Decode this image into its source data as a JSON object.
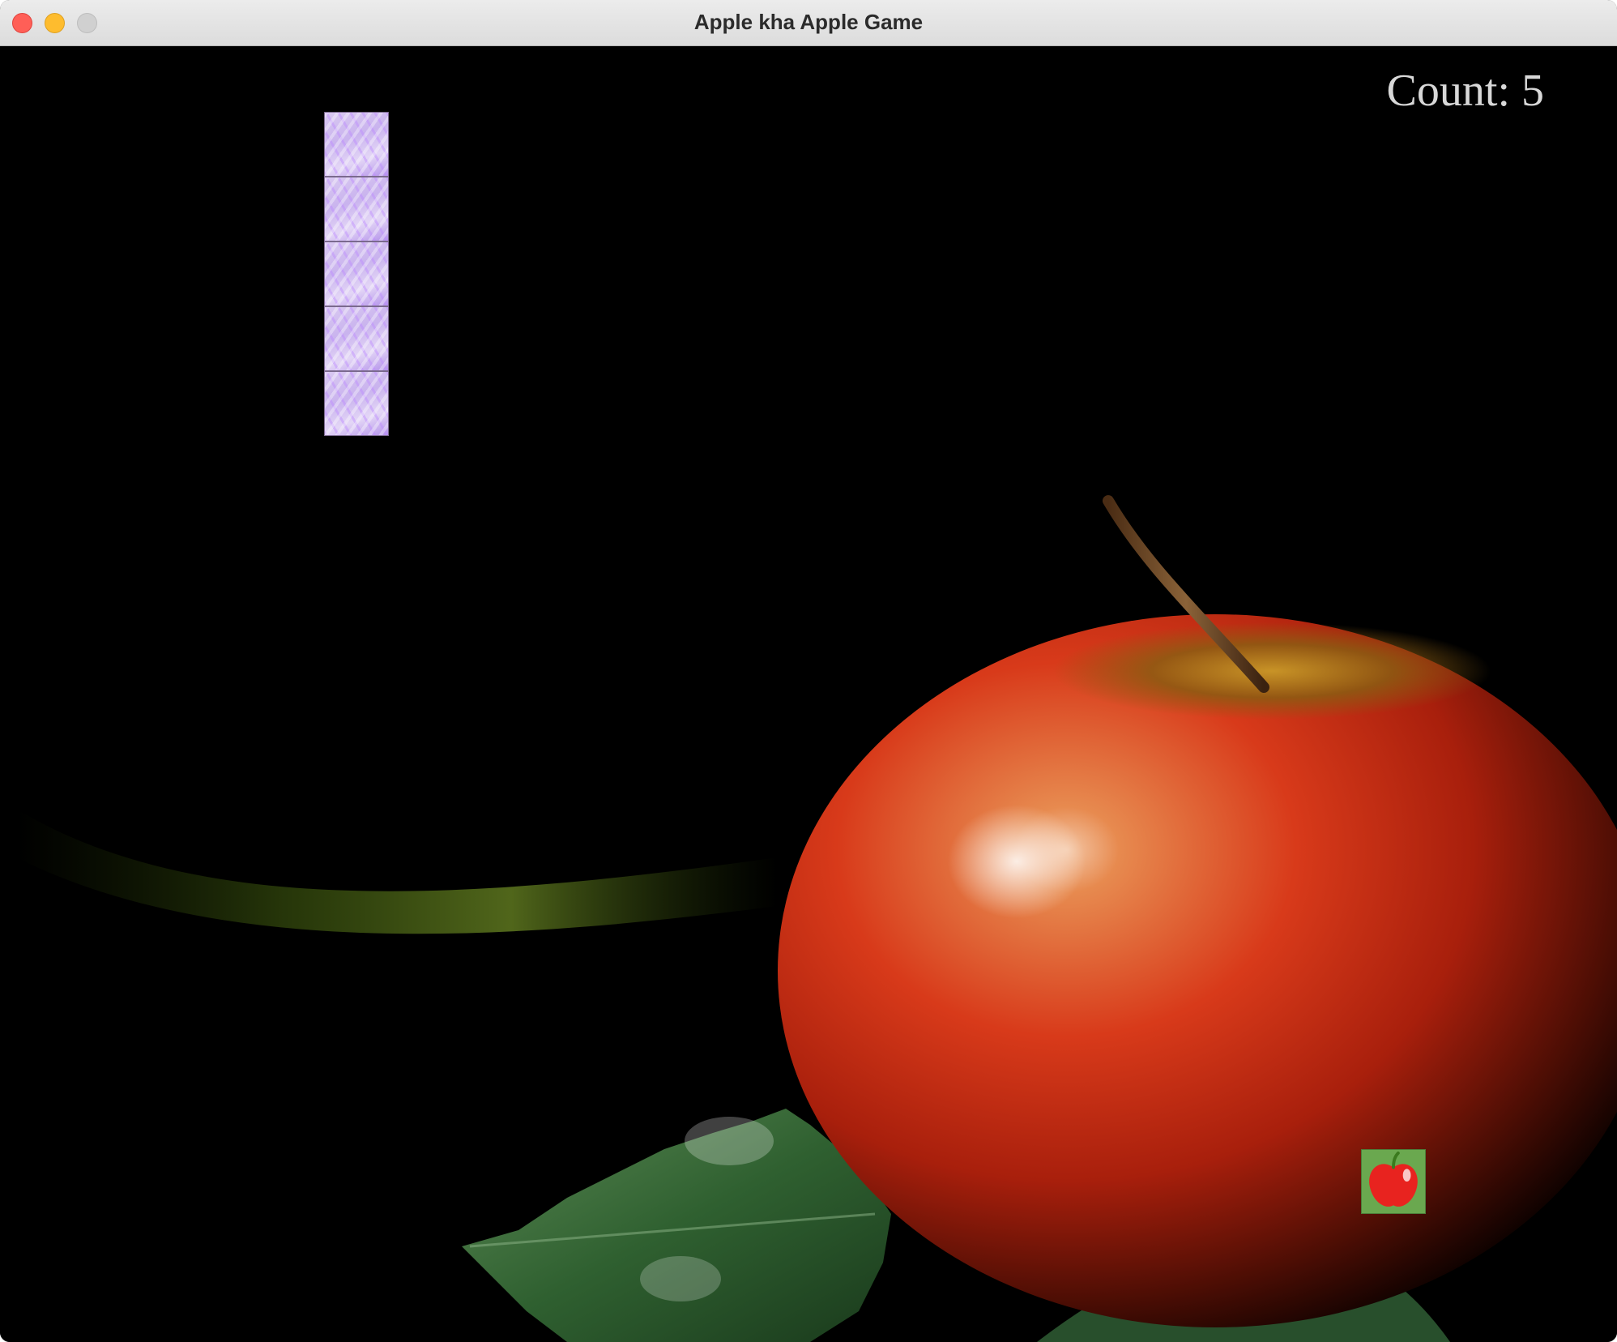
{
  "window": {
    "title": "Apple kha Apple Game"
  },
  "hud": {
    "score_text": "Count: 5",
    "count": 5
  },
  "game": {
    "snake_segments": 5,
    "snake_color": "#c9b3ee",
    "food_icon": "apple-icon",
    "food_bg_color": "#6aa84f",
    "background": "red-apple-with-leaf-on-black"
  }
}
